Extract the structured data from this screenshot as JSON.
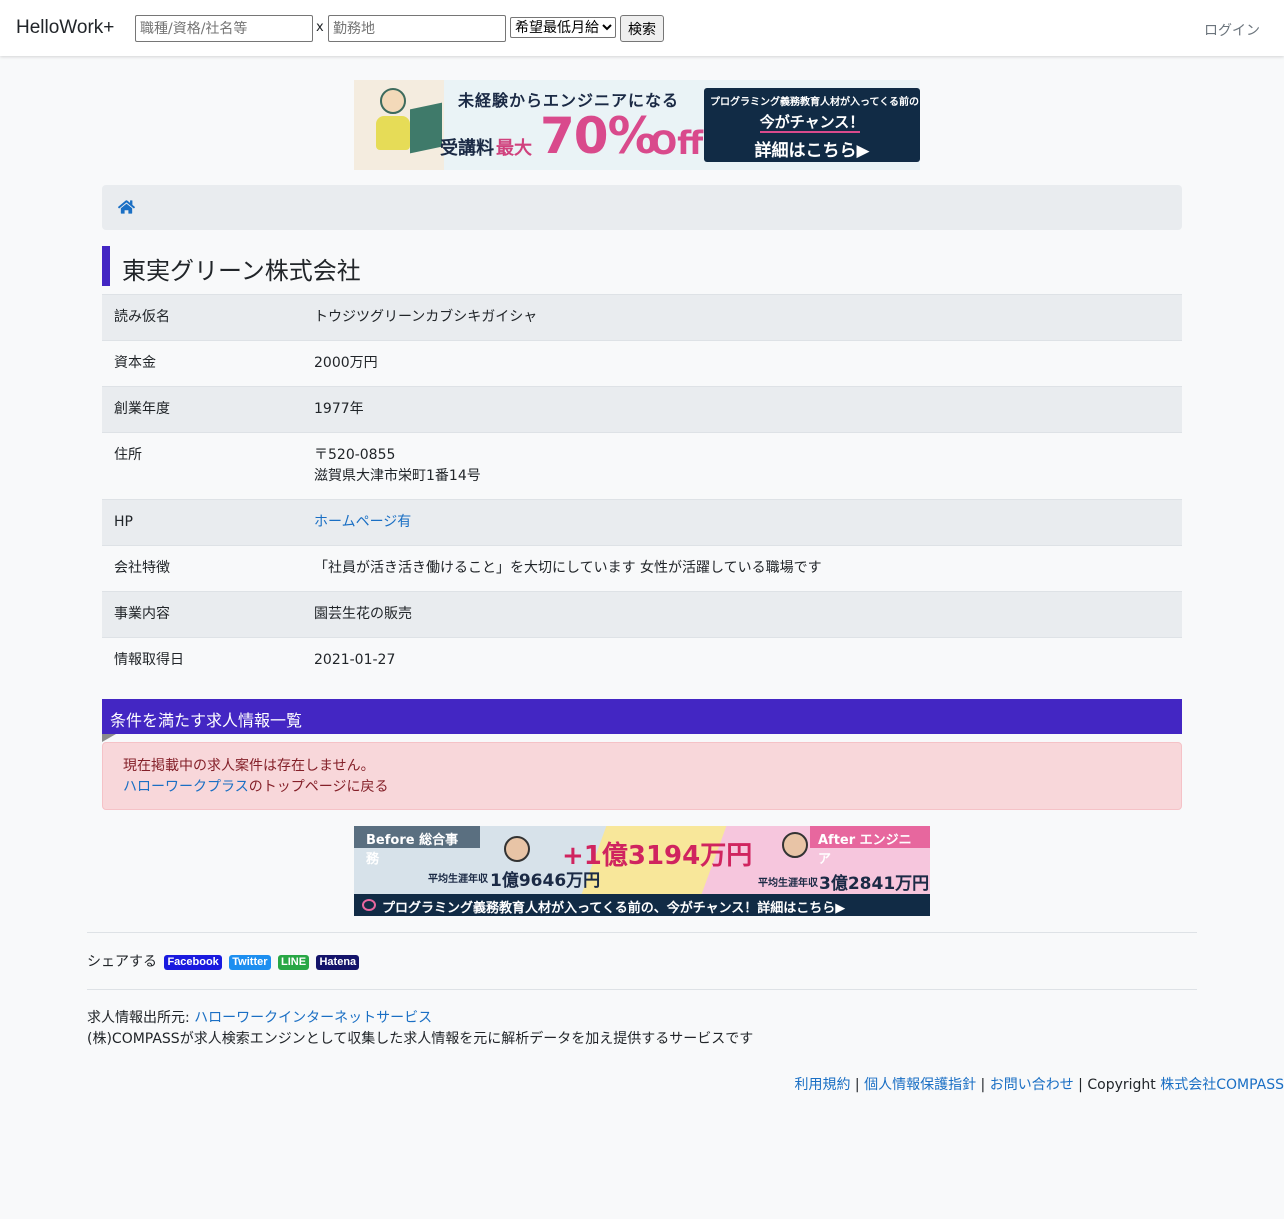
{
  "navbar": {
    "brand": "HelloWork+",
    "keyword_placeholder": "職種/資格/社名等",
    "separator": "x",
    "location_placeholder": "勤務地",
    "salary_selected": "希望最低月給",
    "search_label": "検索",
    "login_label": "ログイン"
  },
  "banner_top": {
    "line1": "未経験からエンジニアになる",
    "fee_label": "受講料",
    "max_label": "最大",
    "discount": "70%",
    "off": "Off",
    "box_line1": "プログラミング義務教育人材が入ってくる前の",
    "box_line2": "今がチャンス！",
    "box_line3": "詳細はこちら▶"
  },
  "company": {
    "name": "東実グリーン株式会社",
    "rows": [
      {
        "label": "読み仮名",
        "value": "トウジツグリーンカブシキガイシャ"
      },
      {
        "label": "資本金",
        "value": "2000万円"
      },
      {
        "label": "創業年度",
        "value": "1977年"
      },
      {
        "label": "住所",
        "value_line1": "〒520-0855",
        "value_line2": "滋賀県大津市栄町1番14号"
      },
      {
        "label": "HP",
        "value": "ホームページ有"
      },
      {
        "label": "会社特徴",
        "value": "「社員が活き活き働けること」を大切にしています 女性が活躍している職場です"
      },
      {
        "label": "事業内容",
        "value": "園芸生花の販売"
      },
      {
        "label": "情報取得日",
        "value": "2021-01-27"
      }
    ]
  },
  "jobs": {
    "heading": "条件を満たす求人情報一覧",
    "empty_message": "現在掲載中の求人案件は存在しません。",
    "back_link": "ハローワークプラス",
    "back_suffix": "のトップページに戻る"
  },
  "banner_bottom": {
    "before": "Before 総合事務",
    "after": "After エンジニア",
    "plus": "+1億3194万円",
    "avg_label": "平均生涯年収",
    "before_value": "1億9646万円",
    "after_value": "3億2841万円",
    "cta": "プログラミング義務教育人材が入ってくる前の、今がチャンス！詳細はこちら▶"
  },
  "share": {
    "label": "シェアする",
    "buttons": [
      "Facebook",
      "Twitter",
      "LINE",
      "Hatena"
    ]
  },
  "source": {
    "label": "求人情報出所元: ",
    "link": "ハローワークインターネットサービス",
    "description": "(株)COMPASSが求人検索エンジンとして収集した求人情報を元に解析データを加え提供するサービスです"
  },
  "footer": {
    "terms": "利用規約",
    "sep": " | ",
    "privacy": "個人情報保護指針",
    "contact": "お問い合わせ",
    "copyright": "Copyright ",
    "company": "株式会社COMPASS"
  },
  "colors": {
    "accent": "#4326c3",
    "link": "#1a6fc4",
    "alert_bg": "#f8d7da",
    "alert_text": "#842029"
  }
}
